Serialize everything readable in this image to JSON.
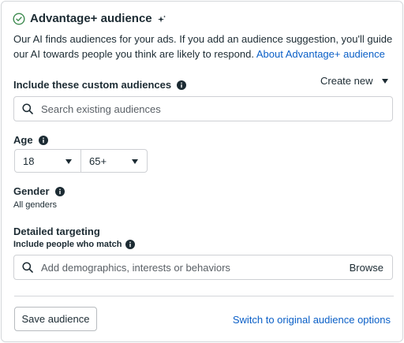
{
  "header": {
    "title": "Advantage+ audience",
    "check_icon": "check-circle-icon",
    "sparkle_icon": "sparkle-icon"
  },
  "description": {
    "text": "Our AI finds audiences for your ads. If you add an audience suggestion, you'll guide our AI towards people you think are likely to respond. ",
    "link": "About Advantage+ audience"
  },
  "custom_audiences": {
    "label": "Include these custom audiences",
    "create_new": "Create new",
    "search_placeholder": "Search existing audiences"
  },
  "age": {
    "label": "Age",
    "min": "18",
    "max": "65+"
  },
  "gender": {
    "label": "Gender",
    "value": "All genders"
  },
  "detailed_targeting": {
    "label": "Detailed targeting",
    "sublabel": "Include people who match",
    "search_placeholder": "Add demographics, interests or behaviors",
    "browse": "Browse"
  },
  "footer": {
    "save_label": "Save audience",
    "switch_label": "Switch to original audience options"
  },
  "colors": {
    "link": "#0a5fc7",
    "text": "#1c2b33",
    "border": "#ced0d4",
    "check_green": "#3c8a4e"
  }
}
